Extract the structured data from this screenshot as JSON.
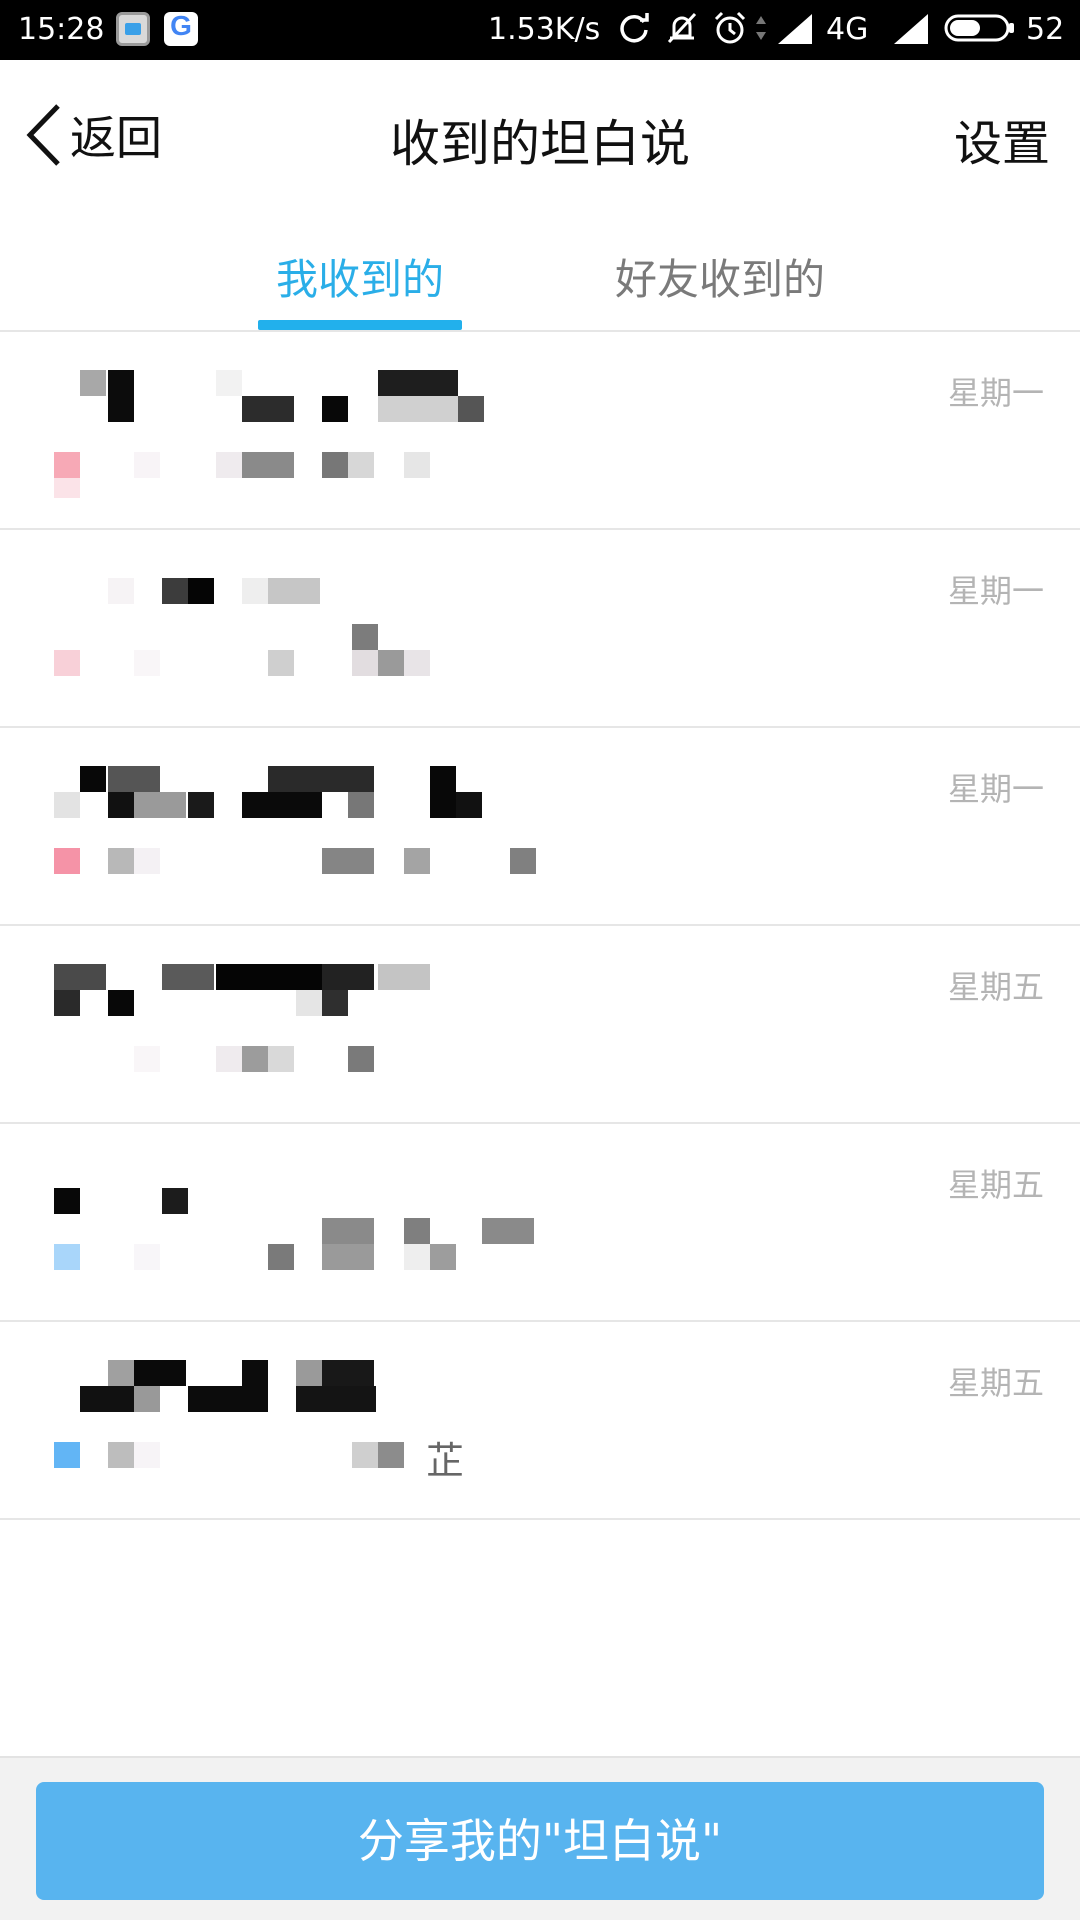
{
  "status_bar": {
    "time": "15:28",
    "net_speed": "1.53K/s",
    "network": "4G",
    "battery": "52",
    "icons": [
      "gallery-icon",
      "google-icon",
      "sync-icon",
      "mute-icon",
      "alarm-icon",
      "signal-icon",
      "battery-icon"
    ]
  },
  "header": {
    "back_label": "返回",
    "title": "收到的坦白说",
    "settings_label": "设置"
  },
  "tabs": [
    {
      "label": "我收到的",
      "active": true
    },
    {
      "label": "好友收到的",
      "active": false
    }
  ],
  "colors": {
    "accent": "#22b0ec",
    "share_button": "#58b4ef",
    "time_text": "#b4b4b4"
  },
  "messages": [
    {
      "time": "星期一",
      "suffix": ""
    },
    {
      "time": "星期一",
      "suffix": ""
    },
    {
      "time": "星期一",
      "suffix": ""
    },
    {
      "time": "星期五",
      "suffix": ""
    },
    {
      "time": "星期五",
      "suffix": ""
    },
    {
      "time": "星期五",
      "suffix": "芷"
    }
  ],
  "share_button_label": "分享我的\"坦白说\""
}
